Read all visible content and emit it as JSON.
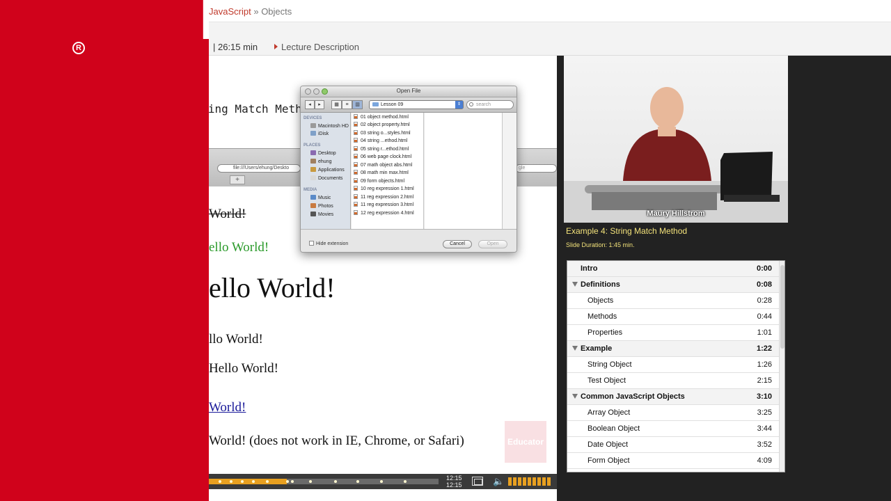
{
  "brand": {
    "name": "Educator",
    "reg_mark": "R"
  },
  "breadcrumb": {
    "parent": "JavaScript",
    "separator": "»",
    "current": "Objects"
  },
  "lecture": {
    "duration": "| 26:15 min",
    "description_link": "Lecture Description"
  },
  "slide": {
    "heading": "String Match Method",
    "url_text": "file:///Users/ehung/Deskto",
    "url_right_text": "gle",
    "tab_plus": "+",
    "lines": [
      "World!",
      "ello World!",
      "ello World!",
      "llo World!",
      "Hello World!",
      "World!",
      "World! (does not work in IE, Chrome, or Safari)"
    ],
    "watermark": "Educator"
  },
  "open_file_dialog": {
    "title": "Open File",
    "location": "Lesson 09",
    "search_placeholder": "search",
    "sidebar": {
      "devices_header": "DEVICES",
      "devices": [
        "Macintosh HD",
        "iDisk"
      ],
      "places_header": "PLACES",
      "places": [
        "Desktop",
        "ehung",
        "Applications",
        "Documents"
      ],
      "media_header": "MEDIA",
      "media": [
        "Music",
        "Photos",
        "Movies"
      ]
    },
    "files": [
      "01 object method.html",
      "02 object property.html",
      "03 string o...styles.html",
      "04 string ...ethod.html",
      "05 string r...ethod.html",
      "06 web page clock.html",
      "07 math object abs.html",
      "08 math min max.html",
      "09 form objects.html",
      "10 reg expression 1.html",
      "11 reg expression 2.html",
      "11 reg expression 3.html",
      "12 reg expression 4.html"
    ],
    "hide_extension_label": "Hide extension",
    "cancel_label": "Cancel",
    "open_label": "Open"
  },
  "player": {
    "progress_fraction": 0.34,
    "current_time": "12:15",
    "total_time": "12:15",
    "volume_fraction": 0.9
  },
  "video": {
    "presenter": "Maury Hillstrom"
  },
  "example": {
    "title": "Example 4: String Match Method",
    "slide_duration": "Slide Duration: 1:45 min."
  },
  "chapters": [
    {
      "label": "Intro",
      "time": "0:00",
      "section": true,
      "toggle": false
    },
    {
      "label": "Definitions",
      "time": "0:08",
      "section": true,
      "toggle": true
    },
    {
      "label": "Objects",
      "time": "0:28",
      "section": false
    },
    {
      "label": "Methods",
      "time": "0:44",
      "section": false
    },
    {
      "label": "Properties",
      "time": "1:01",
      "section": false
    },
    {
      "label": "Example",
      "time": "1:22",
      "section": true,
      "toggle": true
    },
    {
      "label": "String Object",
      "time": "1:26",
      "section": false
    },
    {
      "label": "Test Object",
      "time": "2:15",
      "section": false
    },
    {
      "label": "Common JavaScript Objects",
      "time": "3:10",
      "section": true,
      "toggle": true
    },
    {
      "label": "Array Object",
      "time": "3:25",
      "section": false
    },
    {
      "label": "Boolean Object",
      "time": "3:44",
      "section": false
    },
    {
      "label": "Date Object",
      "time": "3:52",
      "section": false
    },
    {
      "label": "Form Object",
      "time": "4:09",
      "section": false
    }
  ],
  "colors": {
    "brand_red": "#d0021b",
    "accent_yellow": "#f3e27a",
    "progress_orange": "#e8a020"
  }
}
